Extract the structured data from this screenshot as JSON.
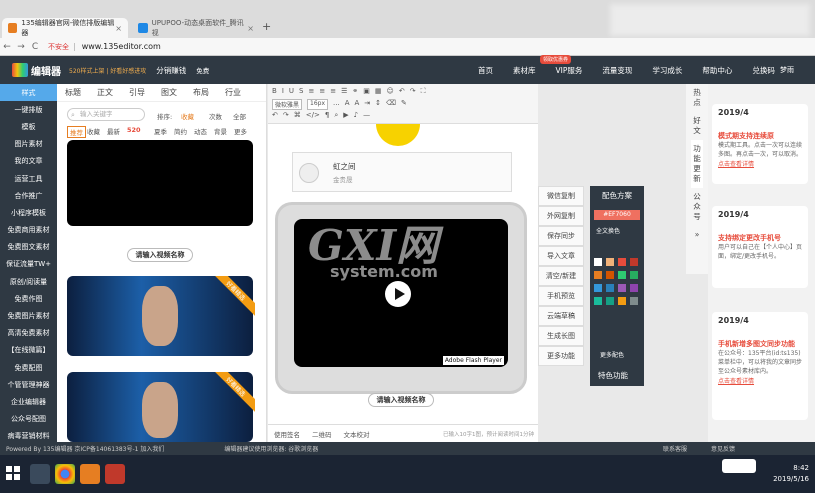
{
  "browser": {
    "tabs": [
      {
        "label": "135编辑器官网-微信排版编辑器",
        "color": "#e67e22"
      },
      {
        "label": "UPUPOO-动态桌面软件_腾讯视",
        "color": "#1e88e5"
      }
    ],
    "new_tab": "+",
    "nav": {
      "back": "←",
      "forward": "→",
      "reload": "C"
    },
    "security": "不安全",
    "url": "www.135editor.com"
  },
  "site": {
    "logo": "编辑器",
    "promo": "520样式上架 | 好看好感进攻",
    "promo2": "分销赚钱",
    "vip_flag": "免费",
    "nav": [
      "首页",
      "素材库",
      "VIP服务",
      "流量变现",
      "学习成长",
      "帮助中心",
      "兑换码"
    ],
    "vip_badge": "领取优惠券",
    "user": "梦雨"
  },
  "left_sidebar": [
    "样式",
    "一键排版",
    "模板",
    "图片素材",
    "我的文章",
    "运营工具",
    "合作推广",
    "小程序模板",
    "免费商用素材",
    "免费图文素材",
    "保证流量TW+",
    "原创/阅读量",
    "免费作图",
    "免费图片素材",
    "高清免费素材",
    "【在线微篇】",
    "免费配图",
    "个管管理神器",
    "企业编辑器",
    "公众号配图",
    "病毒营销材料"
  ],
  "material": {
    "tabs": [
      "标题",
      "正文",
      "引导",
      "图文",
      "布局",
      "行业"
    ],
    "search_placeholder": "输入关键字",
    "sort_label": "排序:",
    "sort_options": [
      "收藏",
      "次数",
      "全部"
    ],
    "filters": [
      "推荐",
      "收藏",
      "最新",
      "520",
      "夏季",
      "简约",
      "动态",
      "背景",
      "更多"
    ],
    "video_name_btn": "请输入视频名称",
    "ribbon": "好看精选"
  },
  "editor": {
    "toolbar_row2": [
      "微软雅黑",
      "16px",
      "..."
    ],
    "music_title": "虹之间",
    "music_artist": "金贵晟",
    "video_name_btn": "请输入视频名称",
    "flash_label": "Adobe Flash Player",
    "footer": [
      "使用签名",
      "二维码",
      "文本校对",
      "已输入10字1图，预计阅读时间1分钟"
    ]
  },
  "actions": [
    "微信复制",
    "外网复制",
    "保存同步",
    "导入文章",
    "清空/新建",
    "手机预览",
    "云端草稿",
    "生成长图",
    "更多功能"
  ],
  "color_panel": {
    "title": "配色方案",
    "hex": "#EF7060",
    "all_color": "全文换色",
    "more": "更多配色",
    "special": "特色功能",
    "swatches": [
      "#ffffff",
      "#f0b27a",
      "#e74c3c",
      "#c0392b",
      "#e67e22",
      "#d35400",
      "#2ecc71",
      "#27ae60",
      "#3498db",
      "#2980b9",
      "#9b59b6",
      "#8e44ad",
      "#1abc9c",
      "#16a085",
      "#f39c12",
      "#7f8c8d"
    ]
  },
  "side_nav": [
    "热点",
    "好文",
    "功能更新",
    "公众号"
  ],
  "news": [
    {
      "date": "2019/4",
      "title": "模式期支持连续原",
      "body": "模式期工具。点击一次可以连续多图。再点击一次，可以取消。",
      "link": "点击查看详情"
    },
    {
      "date": "2019/4",
      "title": "支持绑定更改手机号",
      "body": "用户可以自己在【个人中心】页面，绑定/更改手机号。",
      "link": ""
    },
    {
      "date": "2019/4",
      "title": "手机新增多图文同步功能",
      "body": "在公众号：135平台(id:ts135) 菜单栏中，可以将我的文章同步至公众号素材库内。",
      "link": "点击查看详情"
    }
  ],
  "status_bar": {
    "left": "Powered By 135编辑器 京ICP备14061383号-1 加入我们",
    "mid": "编辑器建议使用浏览器: 谷歌浏览器",
    "right": [
      "联系客服",
      "意见反馈"
    ]
  },
  "watermark": {
    "logo": "GXI网",
    "sub": "system.com"
  },
  "taskbar": {
    "time": "8:42",
    "date": "2019/5/16"
  }
}
